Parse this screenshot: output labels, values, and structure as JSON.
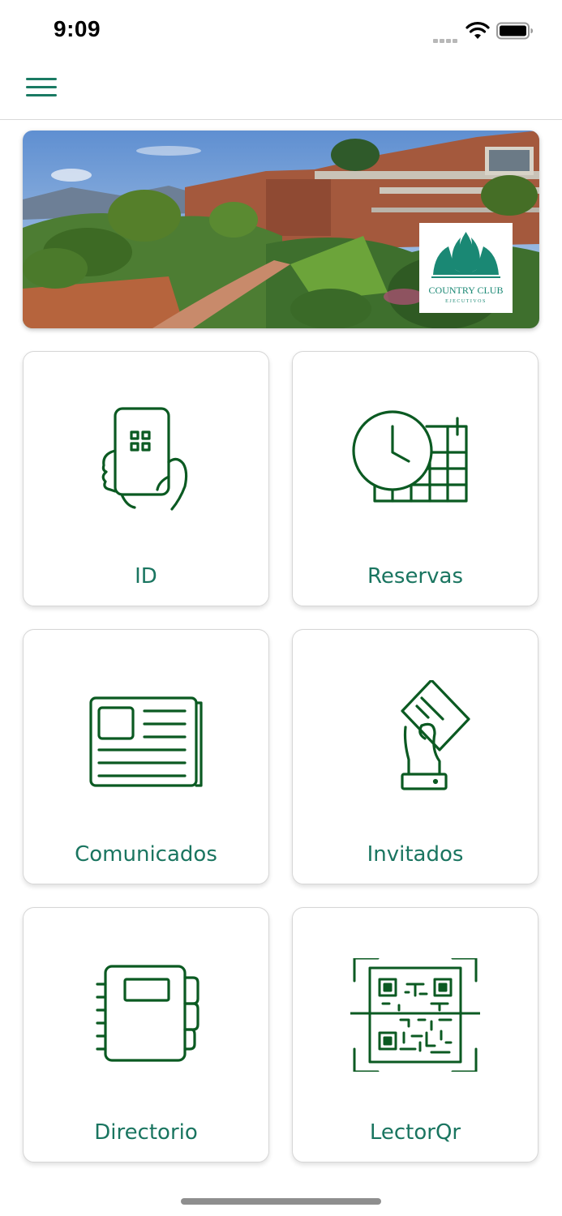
{
  "status_bar": {
    "time": "9:09"
  },
  "banner": {
    "logo_text": "COUNTRY CLUB",
    "logo_subtext": "EJECUTIVOS"
  },
  "tiles": [
    {
      "label": "ID",
      "icon": "phone-qr-icon"
    },
    {
      "label": "Reservas",
      "icon": "clock-calendar-icon"
    },
    {
      "label": "Comunicados",
      "icon": "newspaper-icon"
    },
    {
      "label": "Invitados",
      "icon": "hand-ticket-icon"
    },
    {
      "label": "Directorio",
      "icon": "notebook-icon"
    },
    {
      "label": "LectorQr",
      "icon": "qr-scanner-icon"
    }
  ],
  "colors": {
    "accent": "#1a7560",
    "icon_stroke": "#0b5a22"
  }
}
